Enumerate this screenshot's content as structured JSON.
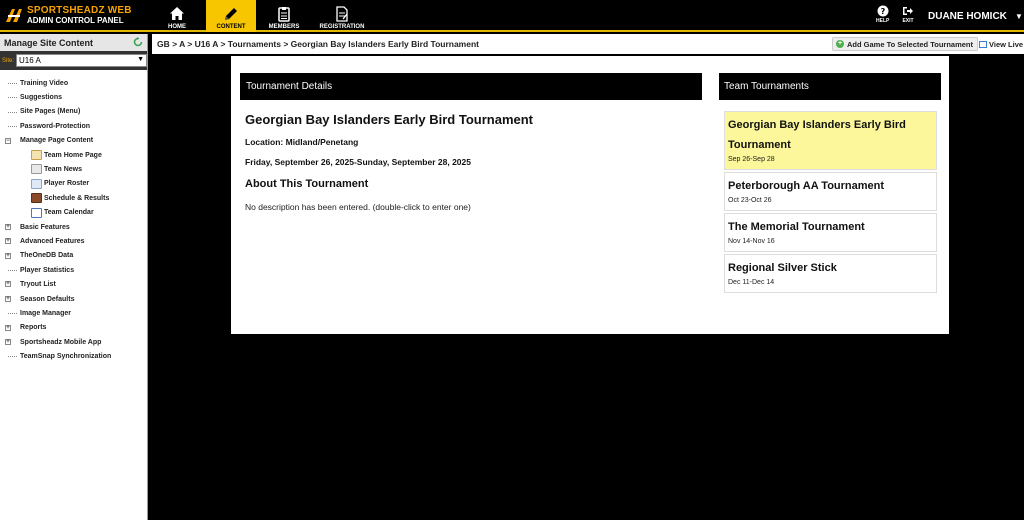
{
  "header": {
    "logo_line1": "SPORTSHEADZ WEB",
    "logo_line2": "ADMIN CONTROL PANEL",
    "nav": [
      {
        "label": "HOME",
        "icon": "home-icon"
      },
      {
        "label": "CONTENT",
        "icon": "pencil-icon",
        "active": true
      },
      {
        "label": "MEMBERS",
        "icon": "clipboard-icon"
      },
      {
        "label": "REGISTRATION",
        "icon": "form-icon"
      }
    ],
    "help_label": "HELP",
    "exit_label": "EXIT",
    "user_name": "DUANE HOMICK",
    "accent_color": "#f7c600"
  },
  "sidebar": {
    "title": "Manage Site Content",
    "site_label": "Site:",
    "site_value": "U16 A",
    "items": [
      {
        "label": "Training Video"
      },
      {
        "label": "Suggestions"
      },
      {
        "label": "Site Pages (Menu)"
      },
      {
        "label": "Password-Protection"
      },
      {
        "label": "Manage Page Content",
        "expanded": true
      },
      {
        "label": "Team Home Page",
        "icon": "home-page-icon"
      },
      {
        "label": "Team News",
        "icon": "news-icon"
      },
      {
        "label": "Player Roster",
        "icon": "roster-icon"
      },
      {
        "label": "Schedule & Results",
        "icon": "schedule-icon"
      },
      {
        "label": "Team Calendar",
        "icon": "calendar-icon"
      },
      {
        "label": "Basic Features"
      },
      {
        "label": "Advanced Features"
      },
      {
        "label": "TheOneDB Data"
      },
      {
        "label": "Player Statistics"
      },
      {
        "label": "Tryout List"
      },
      {
        "label": "Season Defaults"
      },
      {
        "label": "Image Manager"
      },
      {
        "label": "Reports"
      },
      {
        "label": "Sportsheadz Mobile App"
      },
      {
        "label": "TeamSnap Synchronization"
      }
    ]
  },
  "breadcrumb": "GB > A > U16 A > Tournaments > Georgian Bay Islanders Early Bird Tournament",
  "toolbar": {
    "add_game_label": "Add Game To Selected Tournament",
    "view_live_label": "View Live"
  },
  "details": {
    "heading": "Tournament Details",
    "title": "Georgian Bay Islanders Early Bird Tournament",
    "location": "Location: Midland/Penetang",
    "dates": "Friday, September 26, 2025-Sunday, September 28, 2025",
    "about_heading": "About This Tournament",
    "description": "No description has been entered. (double-click to enter one)"
  },
  "team_tournaments": {
    "heading": "Team Tournaments",
    "selected_color": "#fbf79a",
    "items": [
      {
        "name": "Georgian Bay Islanders Early Bird Tournament",
        "dates": "Sep 26-Sep 28",
        "selected": true
      },
      {
        "name": "Peterborough AA Tournament",
        "dates": "Oct 23-Oct 26"
      },
      {
        "name": "The Memorial Tournament",
        "dates": "Nov 14-Nov 16"
      },
      {
        "name": "Regional Silver Stick",
        "dates": "Dec 11-Dec 14"
      }
    ]
  }
}
